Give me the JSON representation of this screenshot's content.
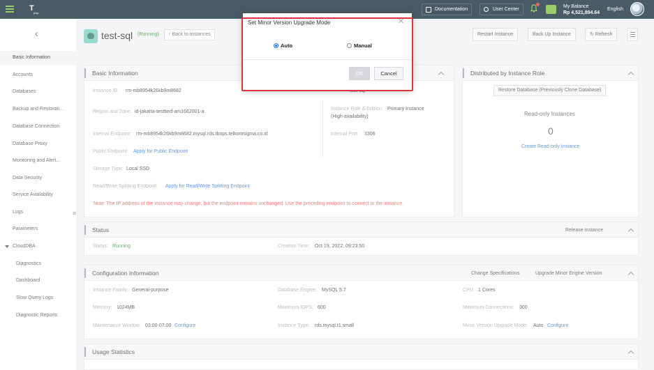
{
  "topbar": {
    "documentation": "Documentation",
    "user_center": "User Center",
    "balance_label": "My Balance",
    "balance_value": "Rp 4,521,894.64",
    "language": "English"
  },
  "sidebar": {
    "items": [
      {
        "label": "Basic Information"
      },
      {
        "label": "Accounts"
      },
      {
        "label": "Databases"
      },
      {
        "label": "Backup and Restorati..."
      },
      {
        "label": "Database Connection"
      },
      {
        "label": "Database Proxy"
      },
      {
        "label": "Monitoring and Alert..."
      },
      {
        "label": "Data Security"
      },
      {
        "label": "Service Availability"
      },
      {
        "label": "Logs"
      },
      {
        "label": "Parameters"
      },
      {
        "label": "CloudDBA"
      },
      {
        "label": "Diagnostics"
      },
      {
        "label": "Dashboard"
      },
      {
        "label": "Slow Query Logs"
      },
      {
        "label": "Diagnostic Reports"
      }
    ]
  },
  "header": {
    "instance_name": "test-sql",
    "status": "(Running)",
    "back_link": "Back to Instances",
    "restart": "Restart Instance",
    "backup": "Back Up Instance",
    "refresh": "Refresh"
  },
  "basic": {
    "title": "Basic Information",
    "instance_id_label": "Instance ID:",
    "instance_id": "rm-mb8954k26kb9m8682",
    "region_label": "Region and Zone:",
    "region": "id-jakarta-testbed-am1662001-a",
    "endpoint_label": "Internal Endpoint:",
    "endpoint": "rm-mb8954k26kb9m8682.mysql.rds.tbops.telkomsigma.co.id",
    "public_label": "Public Endpoint:",
    "public_link": "Apply for Public Endpoint",
    "storage_label": "Storage Type:",
    "storage": "Local SSD",
    "rw_label": "Read/Write Splitting Endpoint:",
    "rw_link": "Apply for Read/Write Splitting Endpoint",
    "note": "Note: The IP address of the instance may change, but the endpoint remains unchanged. Use the preceding endpoint to connect to the instance.",
    "partial_value": "test-sql",
    "role_label": "Instance Role & Edition:",
    "role": "Primary Instance",
    "role_sub": "(High-availability)",
    "port_label": "Internal Port:",
    "port": "3306"
  },
  "distributed": {
    "title": "Distributed by Instance Role",
    "restore_btn": "Restore Database (Previously Clone Database)",
    "readonly_label": "Read-only Instances",
    "readonly_count": "0",
    "create_link": "Create Read-only Instance"
  },
  "status": {
    "title": "Status",
    "release": "Release Instance",
    "status_label": "Status:",
    "status_value": "Running",
    "creation_label": "Creation Time:",
    "creation_value": "Oct 19, 2022, 09:23:50"
  },
  "config": {
    "title": "Configuration Information",
    "change_spec": "Change Specifications",
    "upgrade_minor": "Upgrade Minor Engine Version",
    "family_label": "Instance Family:",
    "family": "General-purpose",
    "engine_label": "Database Engine:",
    "engine": "MySQL 5.7",
    "cpu_label": "CPU:",
    "cpu": "1 Cores",
    "memory_label": "Memory:",
    "memory": "1024MB",
    "iops_label": "Maximum IOPS:",
    "iops": "600",
    "conn_label": "Maximum Connections:",
    "conn": "300",
    "maint_label": "Maintenance Window:",
    "maint": "03:00-07:00",
    "maint_link": "Configure",
    "type_label": "Instance Type:",
    "type": "rds.mysql.t1.small",
    "minor_label": "Minor Version Upgrade Mode:",
    "minor": "Auto",
    "minor_link": "Configure"
  },
  "usage": {
    "title": "Usage Statistics"
  },
  "modal": {
    "title": "Set Minor Version Upgrade Mode",
    "close": "✕",
    "option_auto": "Auto",
    "option_manual": "Manual",
    "selected": "Auto",
    "ok": "OK",
    "cancel": "Cancel"
  }
}
